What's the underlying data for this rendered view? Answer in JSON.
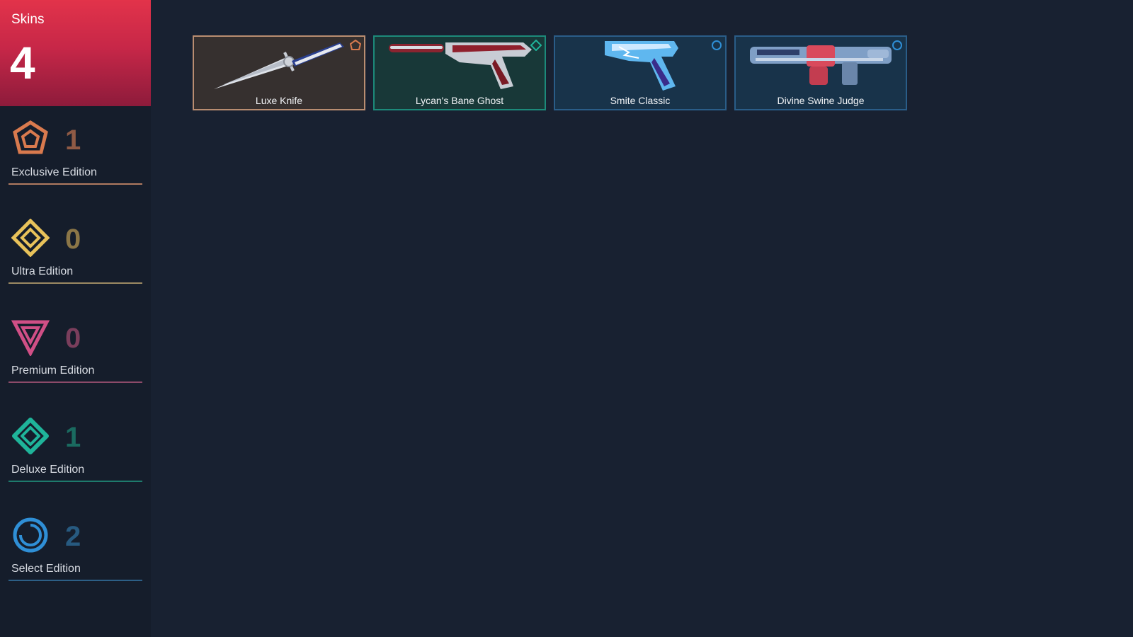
{
  "skins": {
    "label": "Skins",
    "total": "4"
  },
  "tiers": [
    {
      "label": "Exclusive Edition",
      "count": "1",
      "icon": "exclusive-edition-icon",
      "color": "#d97a4e",
      "count_color": "#8f5a45"
    },
    {
      "label": "Ultra Edition",
      "count": "0",
      "icon": "ultra-edition-icon",
      "color": "#e8c25a",
      "count_color": "#8b7647"
    },
    {
      "label": "Premium Edition",
      "count": "0",
      "icon": "premium-edition-icon",
      "color": "#d04f86",
      "count_color": "#7a3e5c"
    },
    {
      "label": "Deluxe Edition",
      "count": "1",
      "icon": "deluxe-edition-icon",
      "color": "#1fb49a",
      "count_color": "#1a6b60"
    },
    {
      "label": "Select Edition",
      "count": "2",
      "icon": "select-edition-icon",
      "color": "#2f8fd6",
      "count_color": "#275a80"
    }
  ],
  "cards": [
    {
      "name": "Luxe Knife",
      "tier": "exclusive",
      "icon": "knife-icon",
      "border": "#b98d71",
      "bg": "#36302f"
    },
    {
      "name": "Lycan's Bane Ghost",
      "tier": "deluxe",
      "icon": "pistol-icon",
      "border": "#1c8a7a",
      "bg": "#183838"
    },
    {
      "name": "Smite Classic",
      "tier": "select",
      "icon": "pistol-icon",
      "border": "#2a5d88",
      "bg": "#18334a"
    },
    {
      "name": "Divine Swine Judge",
      "tier": "select",
      "icon": "shotgun-icon",
      "border": "#2a5d88",
      "bg": "#18334a"
    }
  ]
}
